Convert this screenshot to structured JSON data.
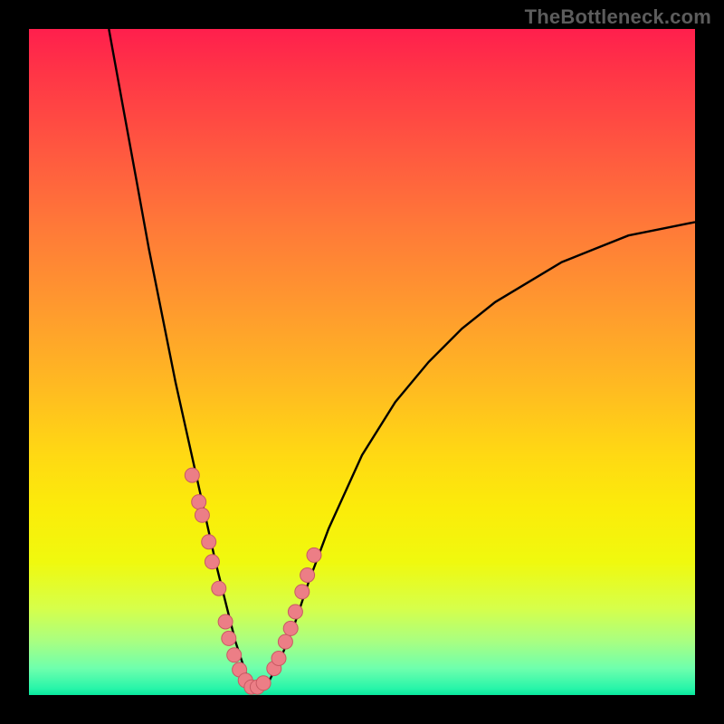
{
  "watermark": "TheBottleneck.com",
  "colors": {
    "frame": "#000000",
    "watermark": "#5c5c5c",
    "curve": "#000000",
    "dot_fill": "#ec7e86",
    "dot_stroke": "#c85a63"
  },
  "chart_data": {
    "type": "line",
    "title": "",
    "xlabel": "",
    "ylabel": "",
    "xlim": [
      0,
      100
    ],
    "ylim": [
      0,
      100
    ],
    "grid": false,
    "legend": false,
    "note": "No numeric axes in image; values are positional estimates (0–100).",
    "series": [
      {
        "name": "main-curve",
        "kind": "line",
        "x": [
          12,
          14,
          16,
          18,
          20,
          22,
          24,
          26,
          28,
          30,
          31,
          32,
          33,
          34,
          35,
          36,
          38,
          40,
          42,
          45,
          50,
          55,
          60,
          65,
          70,
          75,
          80,
          85,
          90,
          95,
          100
        ],
        "y": [
          100,
          89,
          78,
          67,
          57,
          47,
          38,
          29,
          20,
          12,
          8,
          5,
          2,
          1,
          1,
          2,
          6,
          11,
          17,
          25,
          36,
          44,
          50,
          55,
          59,
          62,
          65,
          67,
          69,
          70,
          71
        ]
      },
      {
        "name": "highlighted-points",
        "kind": "scatter",
        "x": [
          24.5,
          25.5,
          26.0,
          27.0,
          27.5,
          28.5,
          29.5,
          30.0,
          30.8,
          31.6,
          32.5,
          33.4,
          34.3,
          35.2,
          36.8,
          37.5,
          38.5,
          39.3,
          40.0,
          41.0,
          41.8,
          42.8
        ],
        "y": [
          33,
          29,
          27,
          23,
          20,
          16,
          11,
          8.5,
          6,
          3.8,
          2.2,
          1.2,
          1.2,
          1.8,
          4,
          5.5,
          8,
          10,
          12.5,
          15.5,
          18,
          21
        ]
      }
    ]
  }
}
